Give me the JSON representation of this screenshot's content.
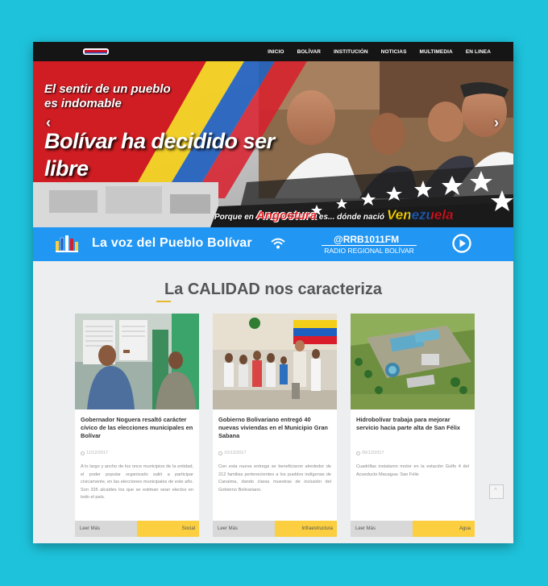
{
  "nav": {
    "items": [
      "INICIO",
      "BOLÍVAR",
      "INSTITUCIÓN",
      "NOTICIAS",
      "MULTIMEDIA",
      "EN LINEA"
    ]
  },
  "hero": {
    "line1": "El sentir de un pueblo es indomable",
    "line2": "Bolívar ha decidido ser libre",
    "bottom_a": "Porque en",
    "bottom_b": "Angostura",
    "bottom_c": "es... dónde nació",
    "bottom_d": "Venezuela",
    "prev": "‹",
    "next": "›"
  },
  "radio": {
    "title": "La voz del Pueblo Bolívar",
    "handle": "@RRB1011FM",
    "subtitle": "RADIO REGIONAL BOLÍVAR"
  },
  "section": {
    "title": "La CALIDAD nos caracteriza"
  },
  "cards": [
    {
      "title": "Gobernador Noguera resaltó carácter cívico de las elecciones municipales en Bolívar",
      "date": "11/12/2017",
      "text": "A lo largo y ancho de los once municipios de la entidad, el poder popular organizado salió a participar cívicamente, en las elecciones municipales de este año. Son 335 alcaldes los que se estiman sean electos en todo el país.",
      "more": "Leer Más",
      "category": "Social"
    },
    {
      "title": "Gobierno Bolivariano entregó 40 nuevas viviendas en el Municipio Gran Sabana",
      "date": "10/12/2017",
      "text": "Con esta nueva entrega se beneficiaron alrededor de 212 familias pertenecientes a los pueblos indígenas de Canaima, dando claras muestras de inclusión del Gobierno Bolivariano.",
      "more": "Leer Más",
      "category": "Infraestructura"
    },
    {
      "title": "Hidrobolívar trabaja para mejorar servicio hacia parte alta de San Félix",
      "date": "09/12/2017",
      "text": "Cuadrillas instalaron motor en la estación Golfo 4 del Acueducto Macagua- San Félix",
      "more": "Leer Más",
      "category": "Agua"
    }
  ],
  "colors": {
    "background": "#1ec3db",
    "radio_bar": "#2196f3",
    "category": "#fbcf3f",
    "topbar": "#151515"
  }
}
